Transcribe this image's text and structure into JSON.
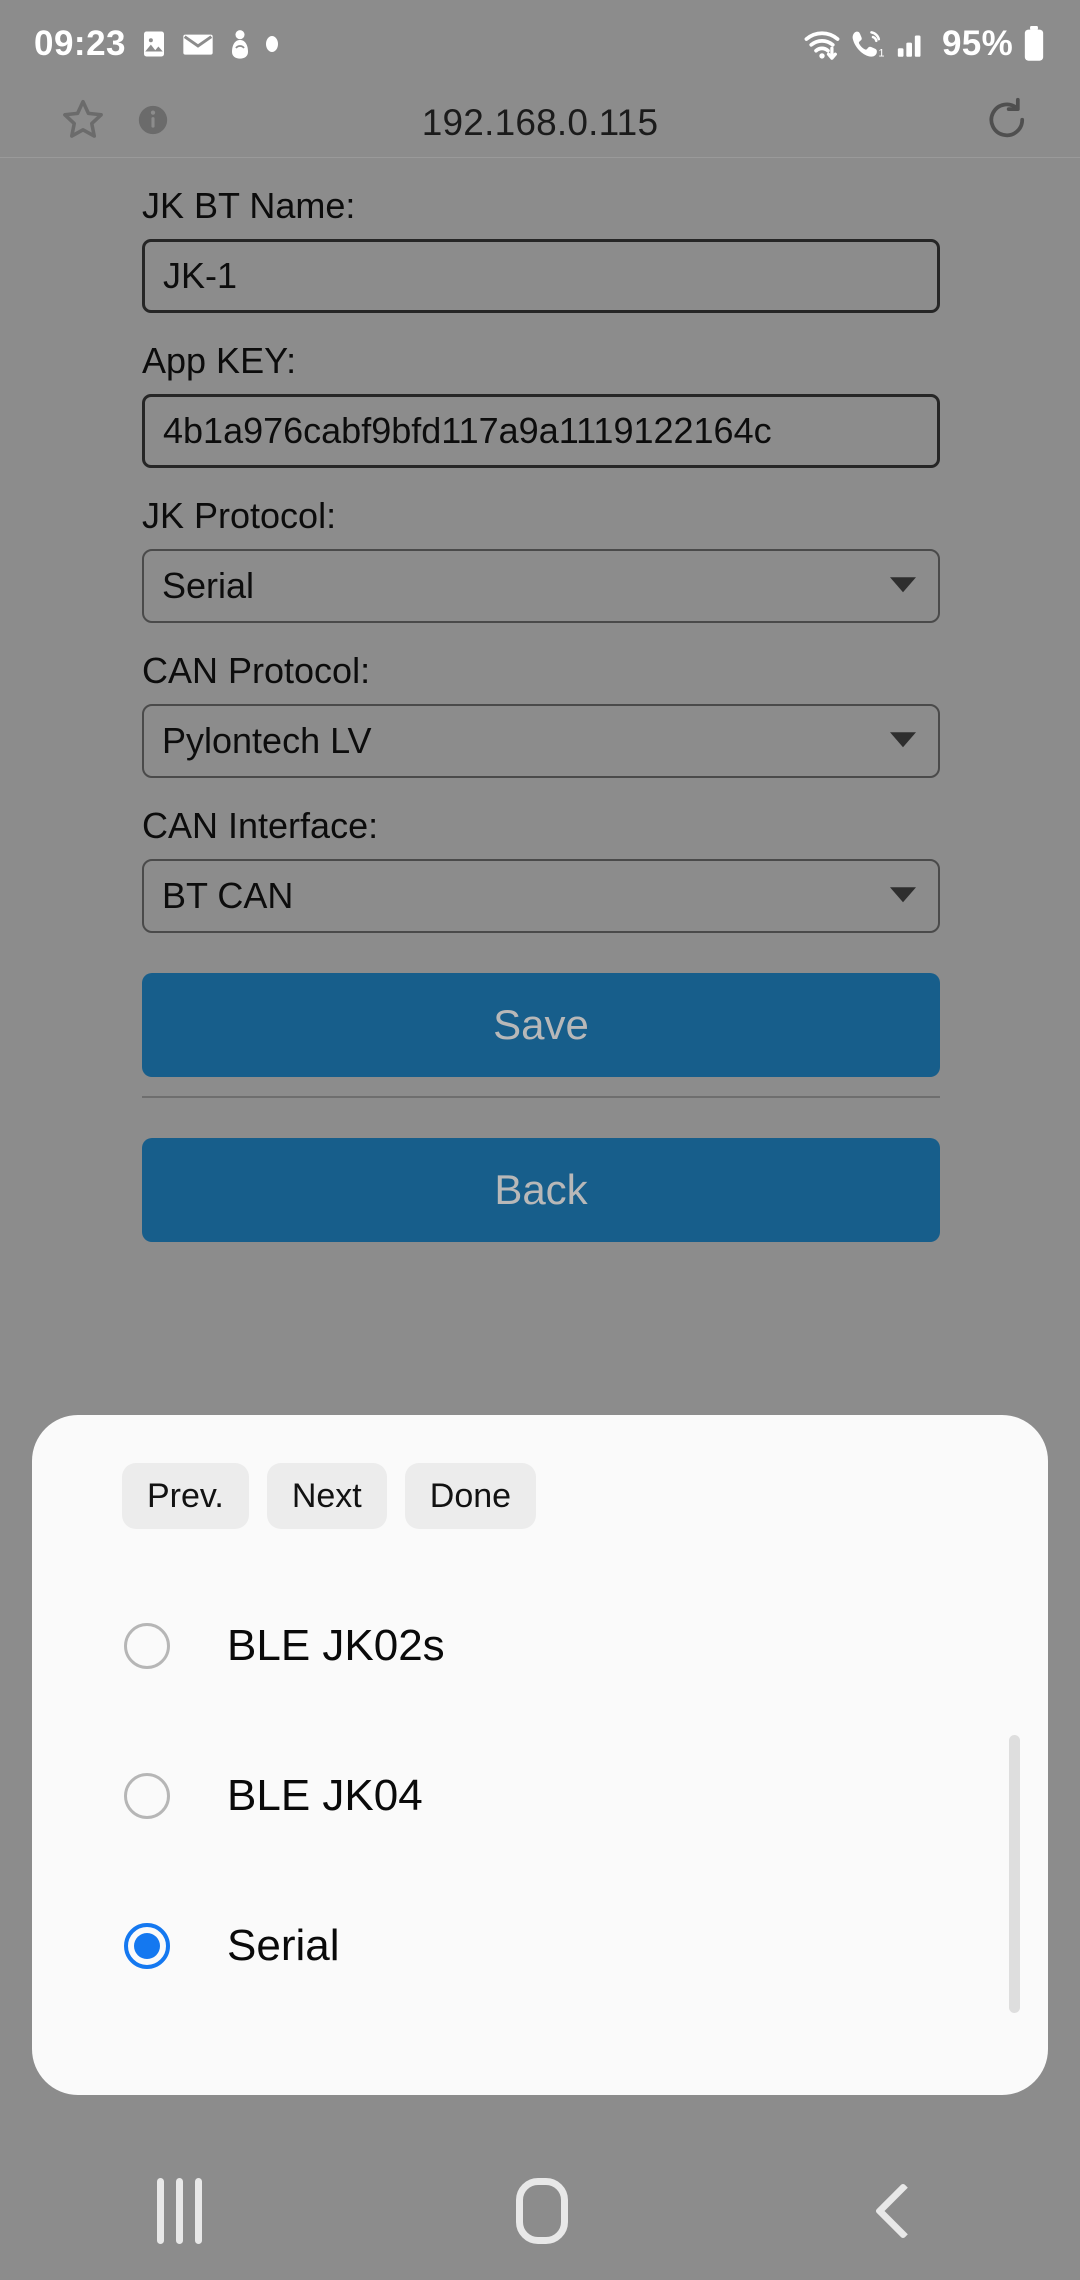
{
  "status_bar": {
    "time": "09:23",
    "left_icons": [
      "photo-icon",
      "mail-icon",
      "app-icon",
      "dot-icon"
    ],
    "right_icons": [
      "wifi-icon",
      "call-icon",
      "signal-icon"
    ],
    "battery_percent": "95%"
  },
  "browser": {
    "url": "192.168.0.115",
    "star_icon": "star-icon",
    "info_icon": "info-icon",
    "reload_icon": "reload-icon"
  },
  "form": {
    "fields": [
      {
        "label": "JK BT Name:",
        "value": "JK-1",
        "type": "text"
      },
      {
        "label": "App KEY:",
        "value": "4b1a976cabf9bfd117a9a1119122164c",
        "type": "text"
      },
      {
        "label": "JK Protocol:",
        "value": "Serial",
        "type": "select"
      },
      {
        "label": "CAN Protocol:",
        "value": "Pylontech LV",
        "type": "select"
      },
      {
        "label": "CAN Interface:",
        "value": "BT CAN",
        "type": "select"
      }
    ],
    "save_label": "Save",
    "back_label": "Back",
    "button_color": "#175e8b",
    "button_text_color": "#b8b8b8"
  },
  "picker_sheet": {
    "toolbar": {
      "prev_label": "Prev.",
      "next_label": "Next",
      "done_label": "Done"
    },
    "options": [
      {
        "label": "BLE JK02s",
        "selected": false
      },
      {
        "label": "BLE JK04",
        "selected": false
      },
      {
        "label": "Serial",
        "selected": true
      }
    ],
    "selected_color": "#1478f0",
    "background": "#fafafa"
  },
  "nav_bar": {
    "recents_label": "recents-icon",
    "home_label": "home-icon",
    "back_label": "back-icon"
  }
}
